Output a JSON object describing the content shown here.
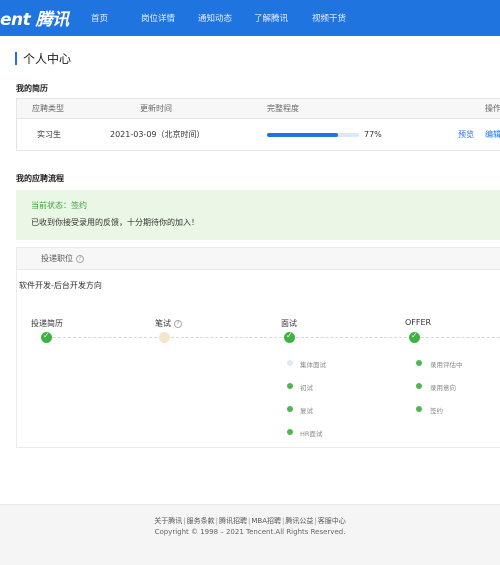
{
  "nav": {
    "brand": "ent 腾讯",
    "items": [
      "首页",
      "岗位详情",
      "通知动态",
      "了解腾讯",
      "视频干货"
    ]
  },
  "page_title": "个人中心",
  "resume": {
    "section_title": "我的简历",
    "headers": [
      "应聘类型",
      "更新时间",
      "完整程度",
      "操作"
    ],
    "row": {
      "type": "实习生",
      "updated": "2021-03-09（北京时间）",
      "completeness_percent": 77,
      "completeness_label": "77%",
      "preview": "预览",
      "edit": "编辑"
    }
  },
  "process": {
    "section_title": "我的应聘流程",
    "status_label": "当前状态：签约",
    "status_message": "已收到你接受录用的反馈，十分期待你的加入！",
    "position_header": "投递职位",
    "position_name": "软件开发-后台开发方向",
    "stages": [
      {
        "label": "投递简历",
        "done": true
      },
      {
        "label": "笔试",
        "done": false
      },
      {
        "label": "面试",
        "done": true
      },
      {
        "label": "OFFER",
        "done": true
      }
    ],
    "interview_steps": [
      {
        "label": "集体面试",
        "done": false
      },
      {
        "label": "初试",
        "done": true
      },
      {
        "label": "复试",
        "done": true
      },
      {
        "label": "HR面试",
        "done": true
      }
    ],
    "offer_steps": [
      {
        "label": "录用评估中",
        "done": true
      },
      {
        "label": "录用意向",
        "done": true
      },
      {
        "label": "签约",
        "done": true
      }
    ]
  },
  "footer": {
    "links": [
      "关于腾讯",
      "服务条款",
      "腾讯招聘",
      "MBA招聘",
      "腾讯公益",
      "客服中心"
    ],
    "copyright": "Copyright © 1998 – 2021 Tencent.All Rights Reserved."
  },
  "colors": {
    "brand_blue": "#1f74e0",
    "success_green": "#3fb33f",
    "status_bg": "#ebf7e6"
  }
}
